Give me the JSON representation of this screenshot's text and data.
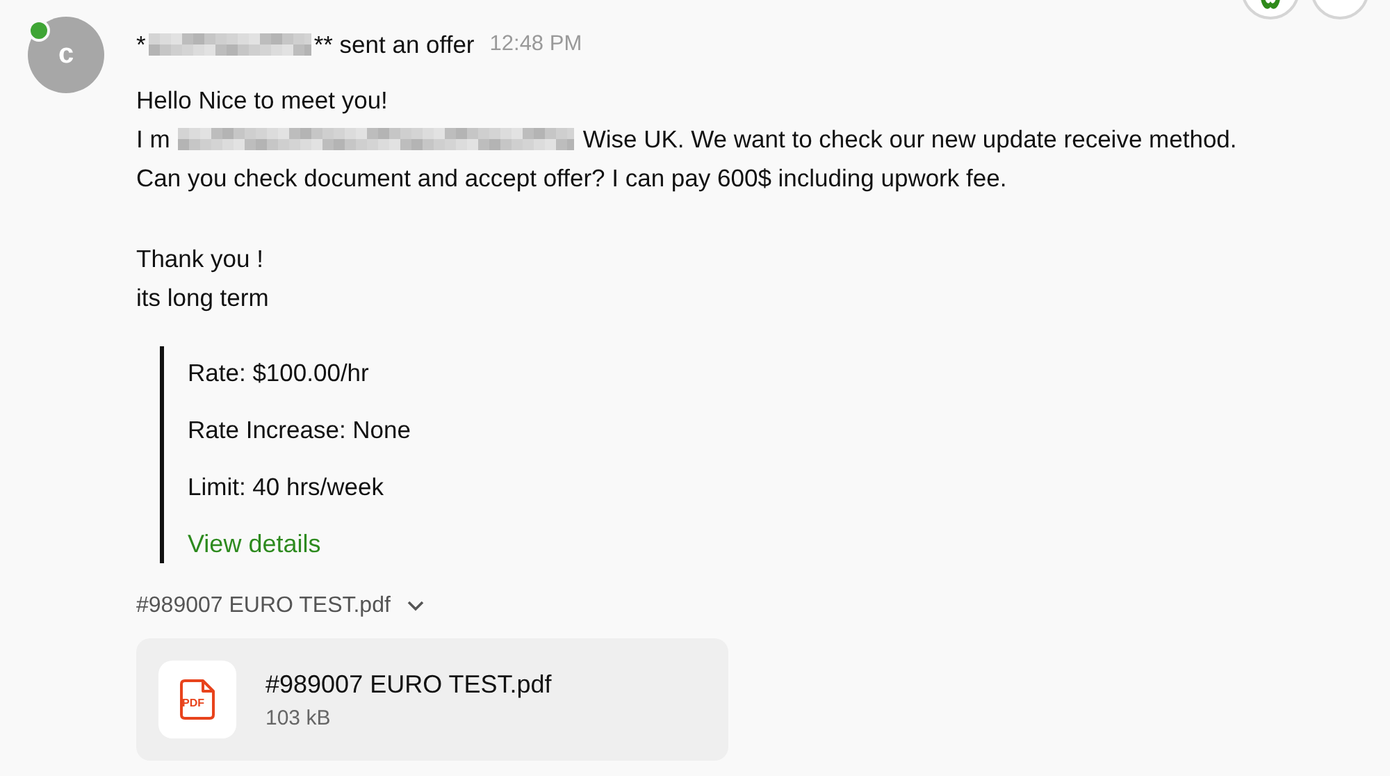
{
  "top_actions": [
    {
      "kind": "accent"
    },
    {
      "kind": "plain"
    }
  ],
  "sender": {
    "avatar_letter": "c",
    "online": true,
    "name_segments": [
      {
        "kind": "text",
        "text": "*"
      },
      {
        "kind": "redacted"
      },
      {
        "kind": "text",
        "text": "** sent an offer"
      }
    ],
    "time": "12:48 PM"
  },
  "message": {
    "paragraphs": [
      [
        [
          {
            "kind": "text",
            "text": "Hello Nice to meet you!"
          }
        ],
        [
          {
            "kind": "text",
            "text": "I m"
          },
          {
            "kind": "redacted"
          },
          {
            "kind": "text",
            "text": "Wise UK. We want to check our new update receive method."
          }
        ],
        [
          {
            "kind": "text",
            "text": "Can you check document and accept offer? I can pay 600$ including upwork fee."
          }
        ]
      ],
      [
        [
          {
            "kind": "text",
            "text": "Thank you !"
          }
        ],
        [
          {
            "kind": "text",
            "text": "its long term"
          }
        ]
      ]
    ]
  },
  "offer": {
    "terms": [
      "Rate: $100.00/hr",
      "Rate Increase: None",
      "Limit: 40 hrs/week"
    ],
    "link": "View details"
  },
  "attachment": {
    "label": "#989007 EURO TEST.pdf",
    "expanded": true,
    "file": {
      "icon_label": "PDF",
      "name": "#989007 EURO TEST.pdf",
      "size": "103 kB"
    }
  }
}
